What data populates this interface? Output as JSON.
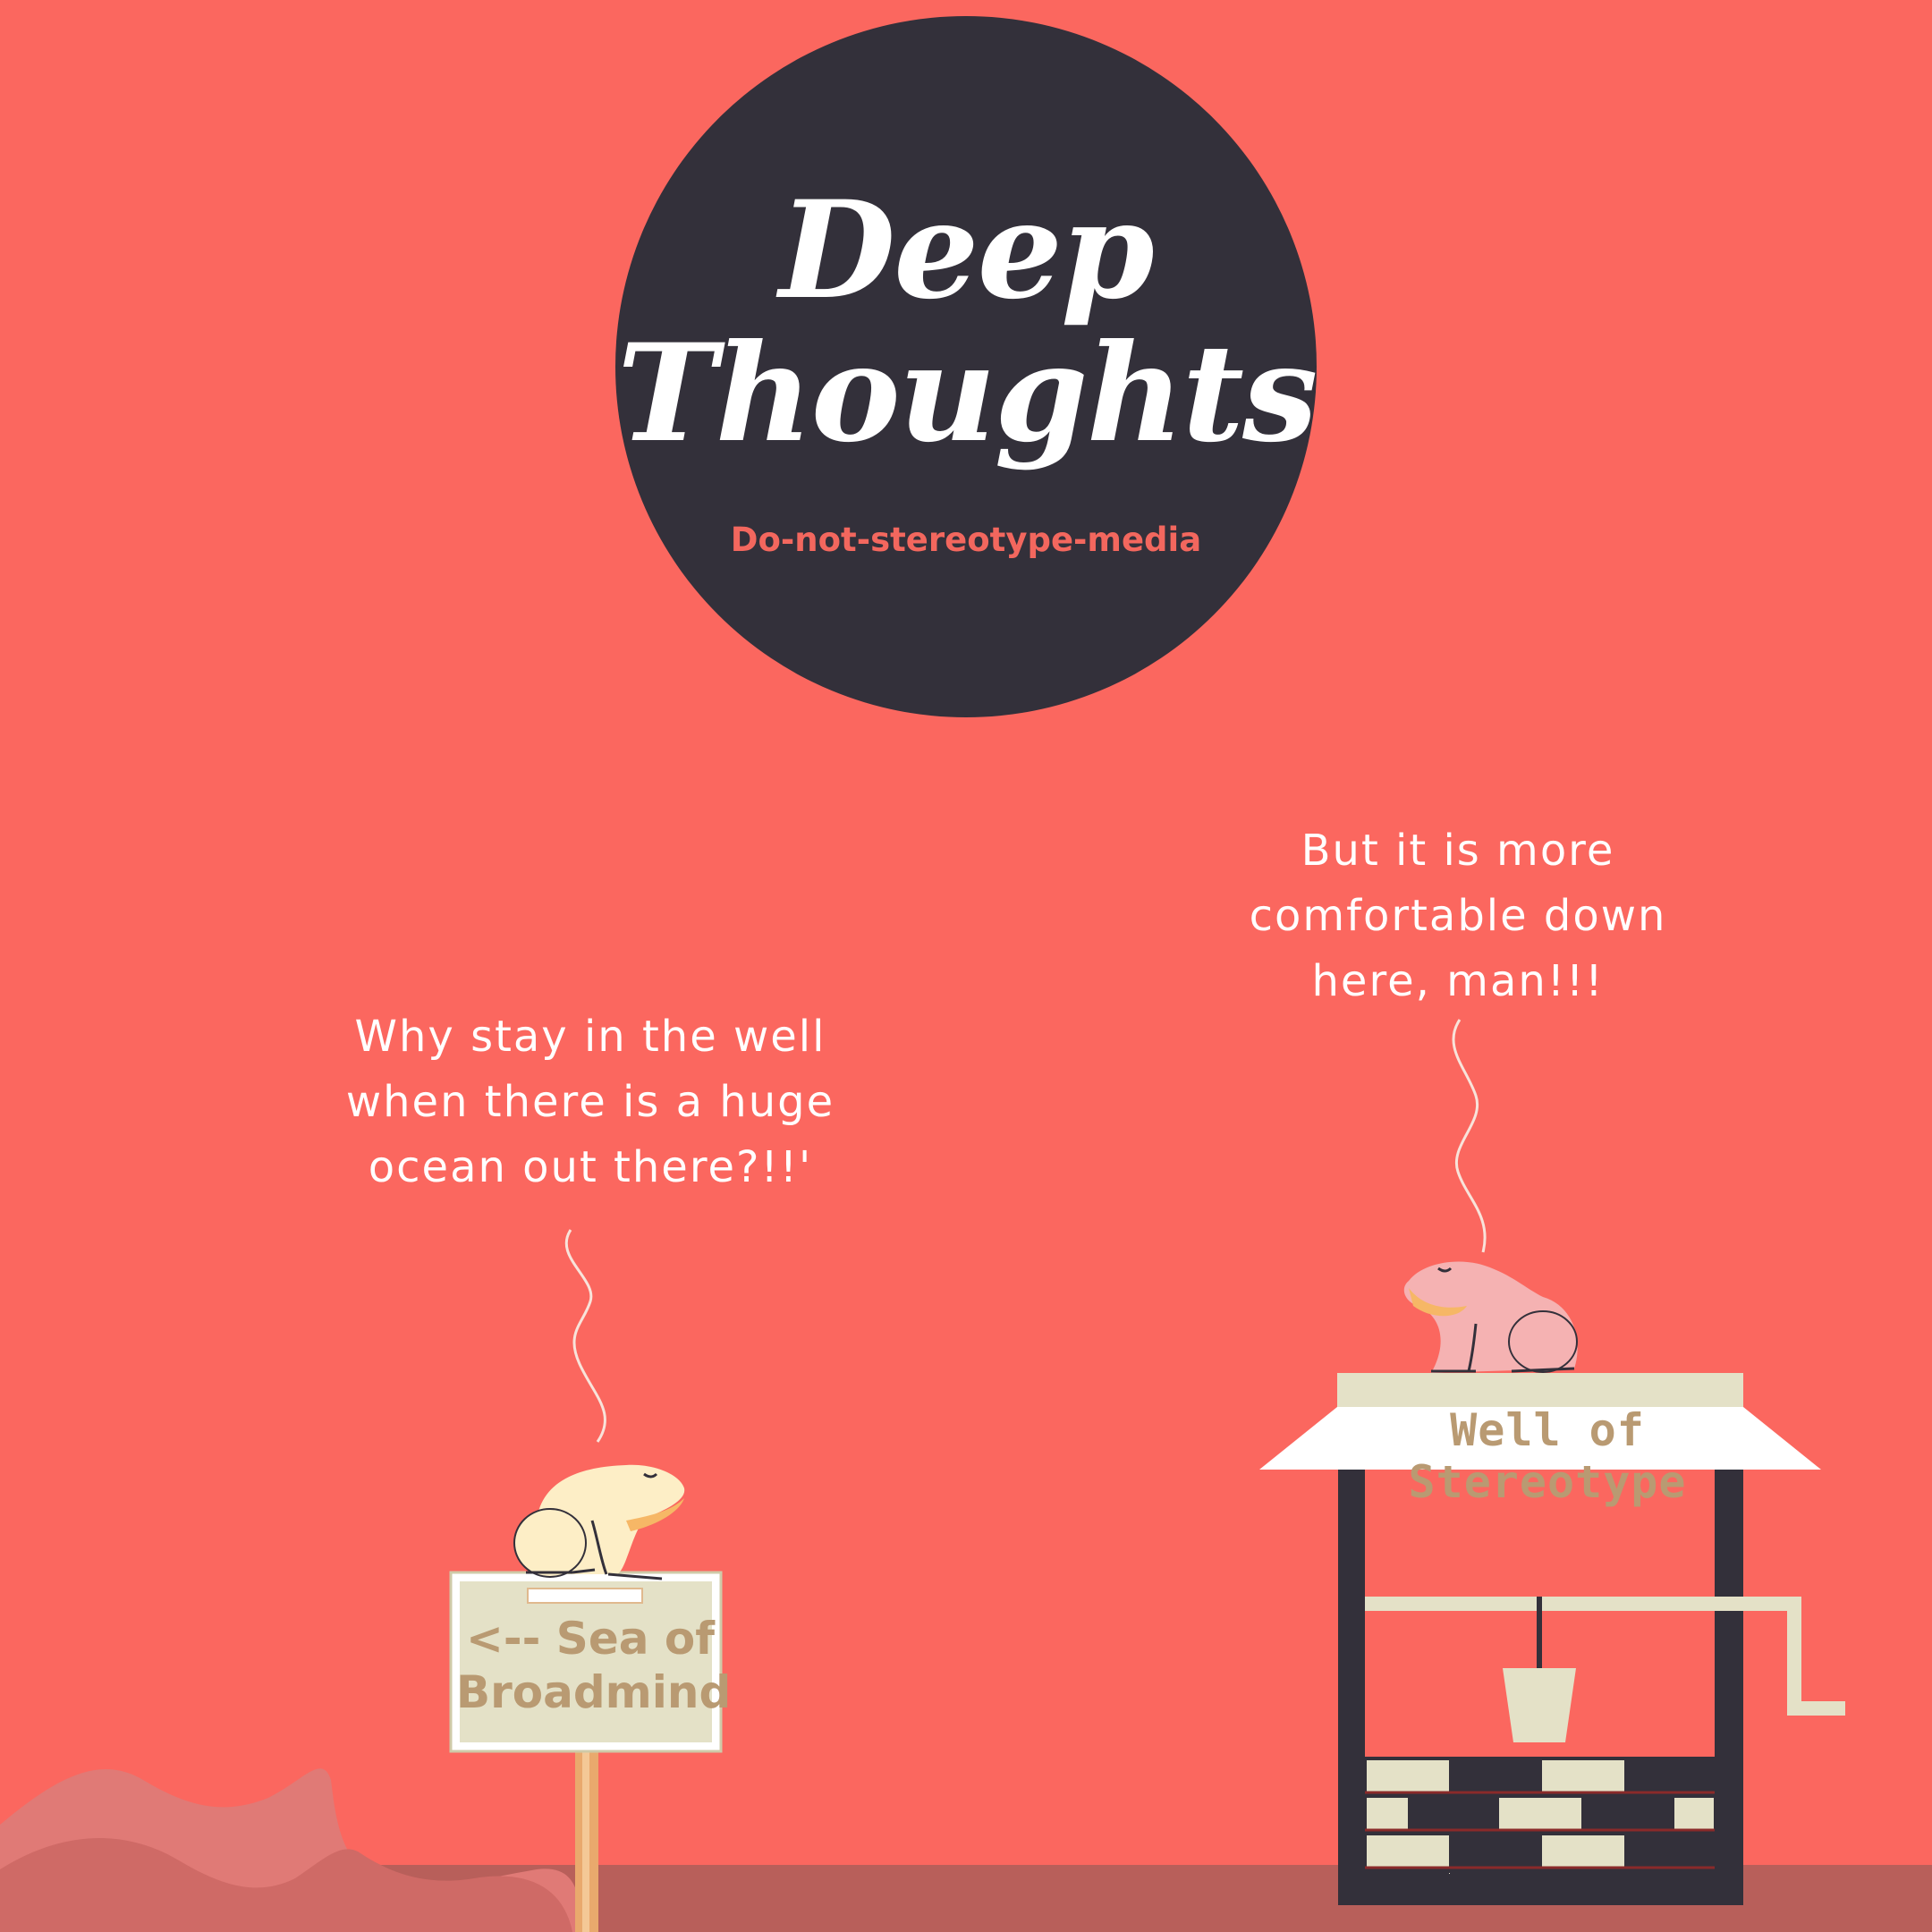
{
  "header": {
    "title_line1": "Deep",
    "title_line2": "Thoughts",
    "subtitle": "Do-not-stereotype-media"
  },
  "left_speech": {
    "lines": [
      "Why stay in the well",
      "when there is a huge",
      "ocean out there?!!'"
    ]
  },
  "right_speech": {
    "lines": [
      "But it is more",
      "comfortable down",
      "here, man!!!"
    ]
  },
  "sign": {
    "line1": "<-- Sea of",
    "line2": "Broadmind"
  },
  "well": {
    "label": "Well of Stereotype"
  },
  "colors": {
    "background": "#fb675f",
    "badge": "#33303a",
    "ground": "#b85f5a",
    "sign_board": "#e4e1c7",
    "text_tan": "#b99a72",
    "frog_left": "#fdeec6",
    "frog_right": "#f5b2b2"
  }
}
